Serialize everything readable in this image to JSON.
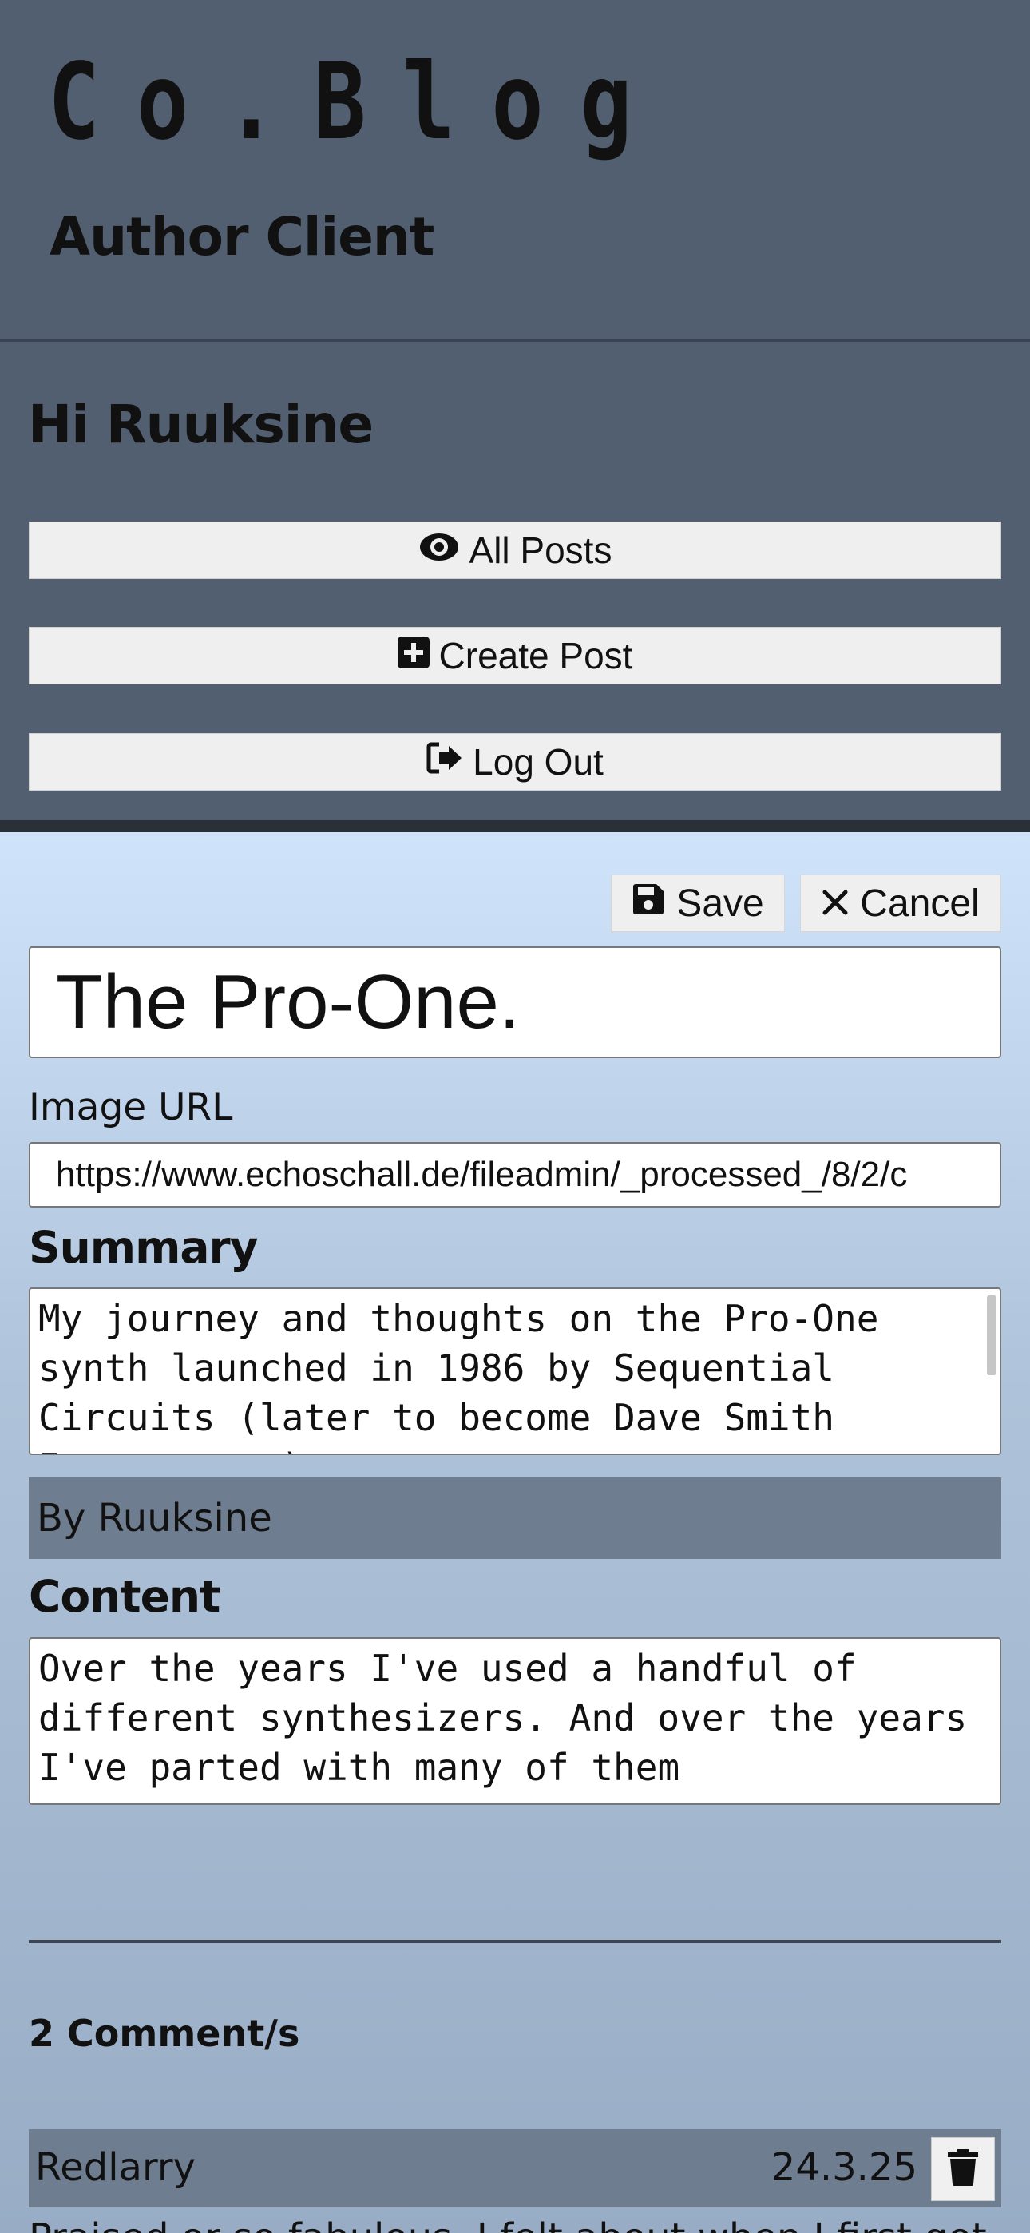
{
  "header": {
    "logo": "Co.Blog",
    "subtitle": "Author Client"
  },
  "nav": {
    "greeting": "Hi Ruuksine",
    "all_posts": "All Posts",
    "create_post": "Create Post",
    "log_out": "Log Out"
  },
  "editor": {
    "save": "Save",
    "cancel": "Cancel",
    "title_value": "The Pro-One.",
    "image_url_label": "Image URL",
    "image_url_value": "https://www.echoschall.de/fileadmin/_processed_/8/2/c",
    "summary_label": "Summary",
    "summary_value": "My journey and thoughts on the Pro-One synth launched in 1986 by Sequential Circuits (later to become Dave Smith Instruments)",
    "byline": "By Ruuksine",
    "content_label": "Content",
    "content_value": "Over the years I've used a handful of different synthesizers. And over the years I've parted with many of them"
  },
  "comments": {
    "heading": "2 Comment/s",
    "items": [
      {
        "author": "Redlarry",
        "date": "24.3.25",
        "text": "Praised or so fabulous. I felt about when I first got"
      }
    ]
  },
  "icons": [
    "eye-icon",
    "plus-square-icon",
    "logout-icon",
    "floppy-disk-icon",
    "close-icon",
    "trash-icon"
  ]
}
